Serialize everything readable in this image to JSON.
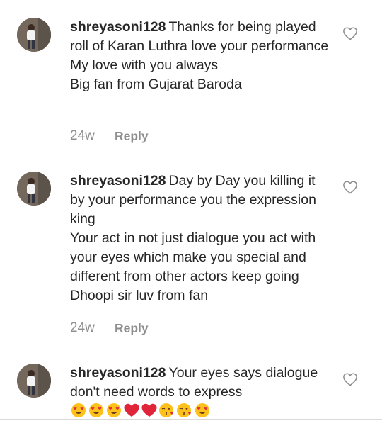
{
  "comments": [
    {
      "username": "shreyasoni128",
      "text": "Thanks for being played roll of Karan Luthra love your performance\nMy love with you always\nBig fan from Gujarat Baroda",
      "time": "24w",
      "reply_label": "Reply",
      "avatar_icon": "user-avatar-photo",
      "like_icon": "heart-outline-icon"
    },
    {
      "username": "shreyasoni128",
      "text": "Day by Day you killing it by your performance you the expression king\nYour act in not just dialogue you act with your eyes which make you special and different from other actors keep going Dhoopi sir luv from fan",
      "time": "24w",
      "reply_label": "Reply",
      "avatar_icon": "user-avatar-photo",
      "like_icon": "heart-outline-icon"
    },
    {
      "username": "shreyasoni128",
      "text": "Your eyes says dialogue don't need words to express",
      "emojis": [
        "smiling-face-with-heart-eyes",
        "smiling-face-with-heart-eyes",
        "smiling-face-with-heart-eyes",
        "red-heart",
        "red-heart",
        "face-blowing-a-kiss",
        "face-blowing-a-kiss",
        "smiling-face-with-heart-eyes"
      ],
      "avatar_icon": "user-avatar-photo",
      "like_icon": "heart-outline-icon"
    }
  ],
  "colors": {
    "text": "#262626",
    "meta": "#8e8e8e",
    "heart_outline": "#8e8e8e",
    "divider": "#dbdbdb"
  }
}
